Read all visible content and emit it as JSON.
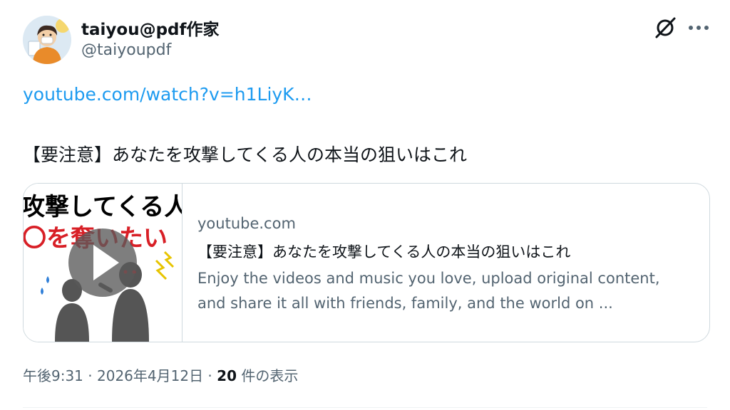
{
  "author": {
    "display_name": "taiyou@pdf作家",
    "handle": "@taiyoupdf",
    "avatar_icon": "avatar-person-icon"
  },
  "actions": {
    "grok_icon": "grok-icon",
    "more_icon": "more-icon"
  },
  "tweet": {
    "link_text": "youtube.com/watch?v=h1LiyK…",
    "text": "【要注意】あなたを攻撃してくる人の本当の狙いはこれ"
  },
  "card": {
    "thumbnail": {
      "line1": "攻撃してくる人は",
      "line2": "〇を奪いたい",
      "play_icon": "play-icon"
    },
    "domain": "youtube.com",
    "title": "【要注意】あなたを攻撃してくる人の本当の狙いはこれ",
    "description_line1": "Enjoy the videos and music you love, upload original content,",
    "description_line2": "and share it all with friends, family, and the world on ..."
  },
  "meta": {
    "time": "午後9:31",
    "separator1": " · ",
    "date": "2026年4月12日",
    "separator2": " · ",
    "views_count": "20",
    "views_label": " 件の表示"
  },
  "colors": {
    "link": "#1d9bf0",
    "text_primary": "#0f1419",
    "text_secondary": "#536471",
    "border": "#cfd9de",
    "thumb_red": "#d81f26"
  }
}
